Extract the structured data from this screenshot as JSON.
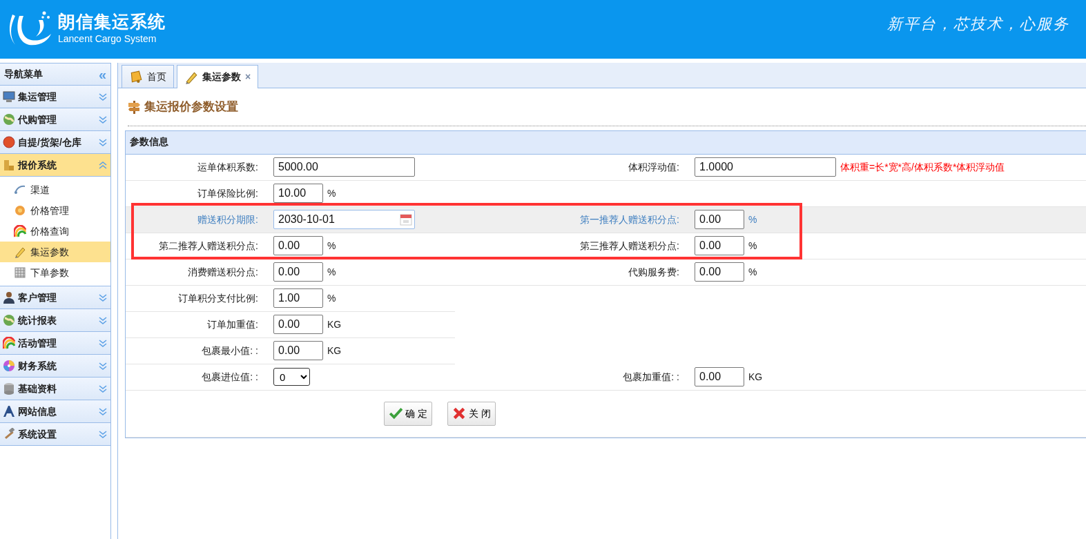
{
  "header": {
    "title": "朗信集运系统",
    "subtitle": "Lancent Cargo System",
    "slogan": "新平台，芯技术，心服务"
  },
  "sidebar": {
    "title": "导航菜单",
    "collapse": "«",
    "groups": [
      {
        "label": "集运管理",
        "expanded": false
      },
      {
        "label": "代购管理",
        "expanded": false
      },
      {
        "label": "自提/货架/仓库",
        "expanded": false
      },
      {
        "label": "报价系统",
        "expanded": true,
        "children": [
          {
            "label": "渠道",
            "selected": false
          },
          {
            "label": "价格管理",
            "selected": false
          },
          {
            "label": "价格查询",
            "selected": false
          },
          {
            "label": "集运参数",
            "selected": true
          },
          {
            "label": "下单参数",
            "selected": false
          }
        ]
      },
      {
        "label": "客户管理",
        "expanded": false
      },
      {
        "label": "统计报表",
        "expanded": false
      },
      {
        "label": "活动管理",
        "expanded": false
      },
      {
        "label": "财务系统",
        "expanded": false
      },
      {
        "label": "基础资料",
        "expanded": false
      },
      {
        "label": "网站信息",
        "expanded": false
      },
      {
        "label": "系统设置",
        "expanded": false
      }
    ]
  },
  "tabs": [
    {
      "label": "首页",
      "selected": false,
      "closable": false
    },
    {
      "label": "集运参数",
      "selected": true,
      "closable": true,
      "close": "×"
    }
  ],
  "page_title": "集运报价参数设置",
  "panel": {
    "title": "参数信息",
    "rows": [
      {
        "highlighted": false,
        "boxed": false,
        "left": {
          "label": "运单体积系数:",
          "value": "5000.00",
          "kind": "wide"
        },
        "right": {
          "label": "体积浮动值:",
          "value": "1.0000",
          "kind": "wide",
          "note": "体积重=长*宽*高/体积系数*体积浮动值"
        }
      },
      {
        "highlighted": false,
        "boxed": false,
        "left": {
          "label": "订单保险比例:",
          "value": "10.00",
          "kind": "short",
          "unit": "%"
        }
      },
      {
        "highlighted": true,
        "boxed": true,
        "left": {
          "label": "赠送积分期限:",
          "value": "2030-10-01",
          "kind": "date"
        },
        "right": {
          "label": "第一推荐人赠送积分点:",
          "value": "0.00",
          "kind": "short",
          "unit": "%"
        }
      },
      {
        "highlighted": false,
        "boxed": true,
        "left": {
          "label": "第二推荐人赠送积分点:",
          "value": "0.00",
          "kind": "short",
          "unit": "%"
        },
        "right": {
          "label": "第三推荐人赠送积分点:",
          "value": "0.00",
          "kind": "short",
          "unit": "%"
        }
      },
      {
        "highlighted": false,
        "boxed": false,
        "left": {
          "label": "消费赠送积分点:",
          "value": "0.00",
          "kind": "short",
          "unit": "%"
        },
        "right": {
          "label": "代购服务费:",
          "value": "0.00",
          "kind": "short",
          "unit": "%"
        }
      },
      {
        "highlighted": false,
        "boxed": false,
        "left": {
          "label": "订单积分支付比例:",
          "value": "1.00",
          "kind": "short",
          "unit": "%"
        }
      },
      {
        "highlighted": false,
        "boxed": false,
        "left": {
          "label": "订单加重值:",
          "value": "0.00",
          "kind": "short",
          "unit": "KG"
        }
      },
      {
        "highlighted": false,
        "boxed": false,
        "left": {
          "label": "包裹最小值: :",
          "value": "0.00",
          "kind": "short",
          "unit": "KG"
        }
      },
      {
        "highlighted": false,
        "boxed": false,
        "left": {
          "label": "包裹进位值: :",
          "value": "0",
          "kind": "select"
        },
        "right": {
          "label": "包裹加重值: :",
          "value": "0.00",
          "kind": "short",
          "unit": "KG"
        }
      }
    ],
    "buttons": [
      {
        "label": "确 定",
        "kind": "ok"
      },
      {
        "label": "关 闭",
        "kind": "close"
      }
    ]
  }
}
